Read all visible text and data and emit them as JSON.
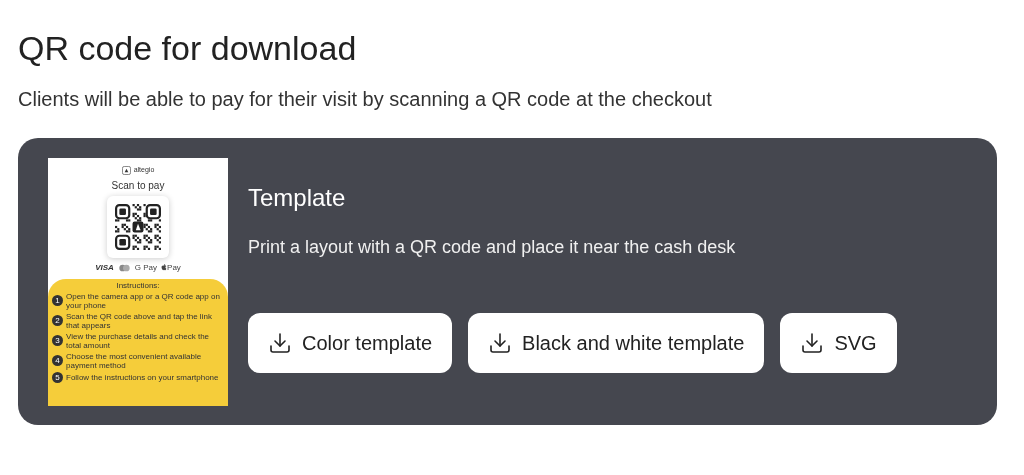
{
  "heading": "QR code for download",
  "subtitle": "Clients will be able to pay for their visit by scanning a QR code at the checkout",
  "card": {
    "preview": {
      "brand": "altegio",
      "title": "Scan to pay",
      "payments": [
        {
          "kind": "text",
          "label": "VISA"
        },
        {
          "kind": "cards"
        },
        {
          "kind": "google",
          "label": "G Pay"
        },
        {
          "kind": "apple",
          "label": "Pay"
        }
      ],
      "instructions_title": "Instructions:",
      "steps": [
        {
          "number": "1",
          "text": "Open the camera app or a QR code app on your phone"
        },
        {
          "number": "2",
          "text": "Scan the QR code above and tap the link that appears"
        },
        {
          "number": "3",
          "text": "View the purchase details and check the total amount"
        },
        {
          "number": "4",
          "text": "Choose the most convenient available payment method"
        },
        {
          "number": "5",
          "text": "Follow the instructions on your smartphone"
        }
      ]
    },
    "title": "Template",
    "description": "Print a layout with a QR code and place it near the cash desk",
    "buttons": [
      {
        "label": "Color template"
      },
      {
        "label": "Black and white template"
      },
      {
        "label": "SVG"
      }
    ]
  }
}
